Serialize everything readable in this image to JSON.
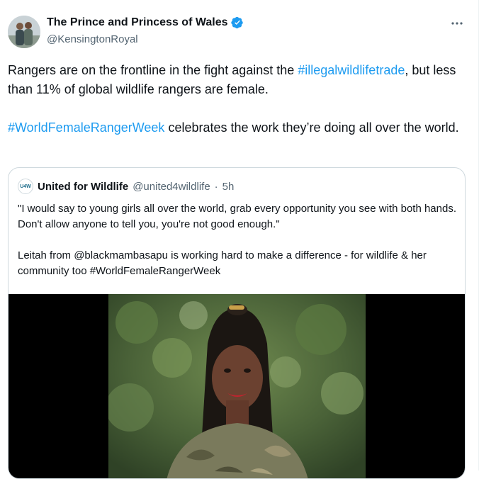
{
  "tweet": {
    "display_name": "The Prince and Princess of Wales",
    "handle": "@KensingtonRoyal",
    "verified_color": "#1d9bf0",
    "icons": {
      "verified": "verified-badge-icon",
      "more": "more-options-icon"
    },
    "text": {
      "p1_before": "Rangers are on the frontline in the fight against the ",
      "p1_hashtag": "#illegalwildlifetrade",
      "p1_after": ", but less than 11% of global wildlife rangers are female.",
      "p2_hashtag": "#WorldFemaleRangerWeek",
      "p2_after": " celebrates the work they’re doing all over the world."
    }
  },
  "quote": {
    "avatar_text": "U4W",
    "display_name": "United for Wildlife",
    "handle": "@united4wildlife",
    "separator": "·",
    "time": "5h",
    "p1": "\"I would say to young girls all over the world, grab every opportunity you see with both hands. Don't allow anyone to tell you, you're not good enough.\"",
    "p2": "Leitah from @blackmambasapu is working hard to make a difference - for wildlife & her community too #WorldFemaleRangerWeek",
    "media": {
      "type": "video",
      "subject": "woman in camouflage uniform, foliage background"
    }
  }
}
